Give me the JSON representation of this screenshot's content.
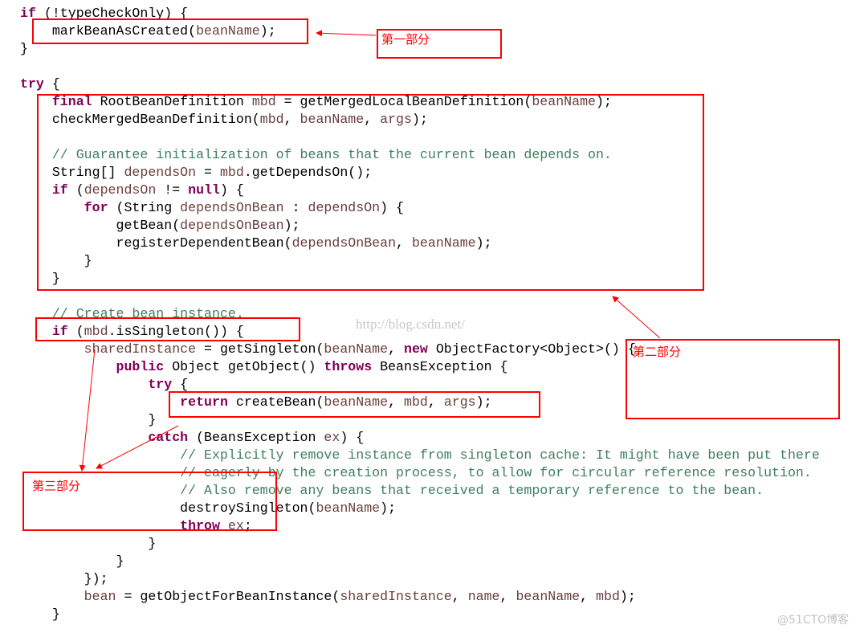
{
  "colors": {
    "keyword": "#7f0055",
    "variable": "#6a3e3e",
    "comment": "#3f7f5f",
    "annotation": "#ff0000"
  },
  "code_lines": [
    [
      [
        "k",
        "if"
      ],
      [
        "p",
        " (!typeCheckOnly) {"
      ]
    ],
    [
      [
        "p",
        "    markBeanAsCreated("
      ],
      [
        "v",
        "beanName"
      ],
      [
        "p",
        ");"
      ]
    ],
    [
      [
        "p",
        "}"
      ]
    ],
    [],
    [
      [
        "k",
        "try"
      ],
      [
        "p",
        " {"
      ]
    ],
    [
      [
        "p",
        "    "
      ],
      [
        "k",
        "final"
      ],
      [
        "p",
        " RootBeanDefinition "
      ],
      [
        "v",
        "mbd"
      ],
      [
        "p",
        " = getMergedLocalBeanDefinition("
      ],
      [
        "v",
        "beanName"
      ],
      [
        "p",
        ");"
      ]
    ],
    [
      [
        "p",
        "    checkMergedBeanDefinition("
      ],
      [
        "v",
        "mbd"
      ],
      [
        "p",
        ", "
      ],
      [
        "v",
        "beanName"
      ],
      [
        "p",
        ", "
      ],
      [
        "v",
        "args"
      ],
      [
        "p",
        ");"
      ]
    ],
    [],
    [
      [
        "p",
        "    "
      ],
      [
        "c",
        "// Guarantee initialization of beans that the current bean depends on."
      ]
    ],
    [
      [
        "p",
        "    String[] "
      ],
      [
        "v",
        "dependsOn"
      ],
      [
        "p",
        " = "
      ],
      [
        "v",
        "mbd"
      ],
      [
        "p",
        ".getDependsOn();"
      ]
    ],
    [
      [
        "p",
        "    "
      ],
      [
        "k",
        "if"
      ],
      [
        "p",
        " ("
      ],
      [
        "v",
        "dependsOn"
      ],
      [
        "p",
        " != "
      ],
      [
        "k",
        "null"
      ],
      [
        "p",
        ") {"
      ]
    ],
    [
      [
        "p",
        "        "
      ],
      [
        "k",
        "for"
      ],
      [
        "p",
        " (String "
      ],
      [
        "v",
        "dependsOnBean"
      ],
      [
        "p",
        " : "
      ],
      [
        "v",
        "dependsOn"
      ],
      [
        "p",
        ") {"
      ]
    ],
    [
      [
        "p",
        "            getBean("
      ],
      [
        "v",
        "dependsOnBean"
      ],
      [
        "p",
        ");"
      ]
    ],
    [
      [
        "p",
        "            registerDependentBean("
      ],
      [
        "v",
        "dependsOnBean"
      ],
      [
        "p",
        ", "
      ],
      [
        "v",
        "beanName"
      ],
      [
        "p",
        ");"
      ]
    ],
    [
      [
        "p",
        "        }"
      ]
    ],
    [
      [
        "p",
        "    }"
      ]
    ],
    [],
    [
      [
        "p",
        "    "
      ],
      [
        "c",
        "// Create bean instance."
      ]
    ],
    [
      [
        "p",
        "    "
      ],
      [
        "k",
        "if"
      ],
      [
        "p",
        " ("
      ],
      [
        "v",
        "mbd"
      ],
      [
        "p",
        ".isSingleton()) {"
      ]
    ],
    [
      [
        "p",
        "        "
      ],
      [
        "v",
        "sharedInstance"
      ],
      [
        "p",
        " = getSingleton("
      ],
      [
        "v",
        "beanName"
      ],
      [
        "p",
        ", "
      ],
      [
        "k",
        "new"
      ],
      [
        "p",
        " ObjectFactory<Object>() {"
      ]
    ],
    [
      [
        "p",
        "            "
      ],
      [
        "k",
        "public"
      ],
      [
        "p",
        " Object getObject() "
      ],
      [
        "k",
        "throws"
      ],
      [
        "p",
        " BeansException {"
      ]
    ],
    [
      [
        "p",
        "                "
      ],
      [
        "k",
        "try"
      ],
      [
        "p",
        " {"
      ]
    ],
    [
      [
        "p",
        "                    "
      ],
      [
        "k",
        "return"
      ],
      [
        "p",
        " createBean("
      ],
      [
        "v",
        "beanName"
      ],
      [
        "p",
        ", "
      ],
      [
        "v",
        "mbd"
      ],
      [
        "p",
        ", "
      ],
      [
        "v",
        "args"
      ],
      [
        "p",
        ");"
      ]
    ],
    [
      [
        "p",
        "                }"
      ]
    ],
    [
      [
        "p",
        "                "
      ],
      [
        "k",
        "catch"
      ],
      [
        "p",
        " (BeansException "
      ],
      [
        "v",
        "ex"
      ],
      [
        "p",
        ") {"
      ]
    ],
    [
      [
        "p",
        "                    "
      ],
      [
        "c",
        "// Explicitly remove instance from singleton cache: It might have been put there"
      ]
    ],
    [
      [
        "p",
        "                    "
      ],
      [
        "c",
        "// eagerly by the creation process, to allow for circular reference resolution."
      ]
    ],
    [
      [
        "p",
        "                    "
      ],
      [
        "c",
        "// Also remove any beans that received a temporary reference to the bean."
      ]
    ],
    [
      [
        "p",
        "                    destroySingleton("
      ],
      [
        "v",
        "beanName"
      ],
      [
        "p",
        ");"
      ]
    ],
    [
      [
        "p",
        "                    "
      ],
      [
        "k",
        "throw"
      ],
      [
        "p",
        " "
      ],
      [
        "v",
        "ex"
      ],
      [
        "p",
        ";"
      ]
    ],
    [
      [
        "p",
        "                }"
      ]
    ],
    [
      [
        "p",
        "            }"
      ]
    ],
    [
      [
        "p",
        "        });"
      ]
    ],
    [
      [
        "p",
        "        "
      ],
      [
        "v",
        "bean"
      ],
      [
        "p",
        " = getObjectForBeanInstance("
      ],
      [
        "v",
        "sharedInstance"
      ],
      [
        "p",
        ", "
      ],
      [
        "v",
        "name"
      ],
      [
        "p",
        ", "
      ],
      [
        "v",
        "beanName"
      ],
      [
        "p",
        ", "
      ],
      [
        "v",
        "mbd"
      ],
      [
        "p",
        ");"
      ]
    ],
    [
      [
        "p",
        "    }"
      ]
    ]
  ],
  "annotations": {
    "part1": "第一部分",
    "part2": "第二部分",
    "part3": "第三部分"
  },
  "watermarks": {
    "csdn": "http://blog.csdn.net/",
    "cto": "@51CTO博客"
  }
}
